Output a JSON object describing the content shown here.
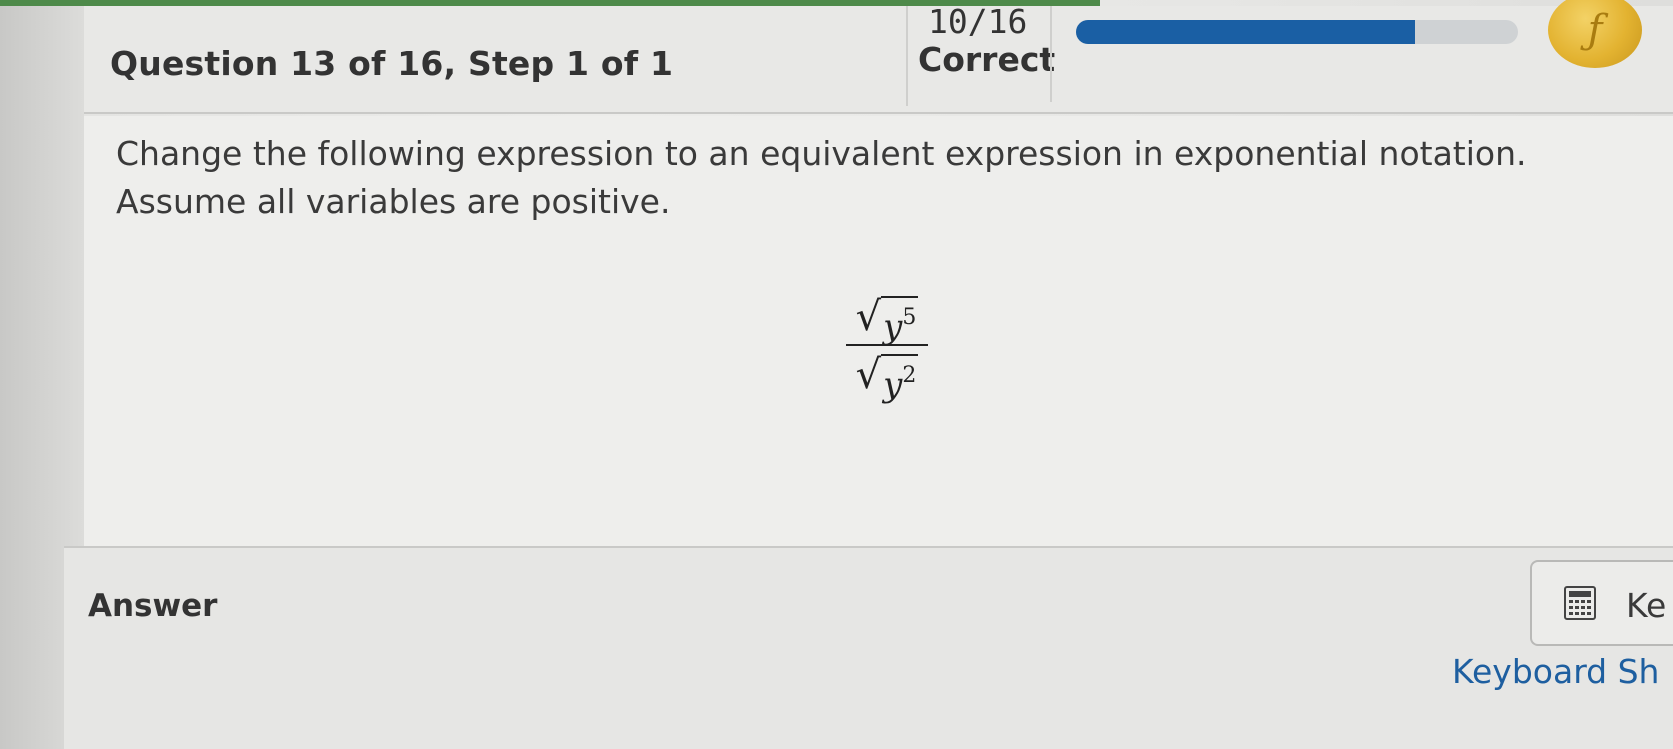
{
  "header": {
    "question_title": "Question 13 of 16, Step 1 of 1",
    "score": "10/16",
    "score_label": "Correct",
    "progress_fraction": 0.7663
  },
  "question": {
    "prompt": "Change the following expression to an equivalent expression in exponential notation. Assume all variables are positive.",
    "expression": {
      "numerator": {
        "radical": "√",
        "base": "y",
        "exponent": "5"
      },
      "denominator": {
        "radical": "√",
        "base": "y",
        "exponent": "2"
      }
    }
  },
  "answer": {
    "label": "Answer",
    "keypad_label": "Ke",
    "shortcuts_label": "Keyboard Sh"
  },
  "colors": {
    "progress_fill": "#1a5fa4",
    "link": "#1e5fa0",
    "badge": "#e3b331"
  },
  "icons": {
    "calculator": "calculator-icon",
    "badge": "achievement-badge-icon"
  }
}
